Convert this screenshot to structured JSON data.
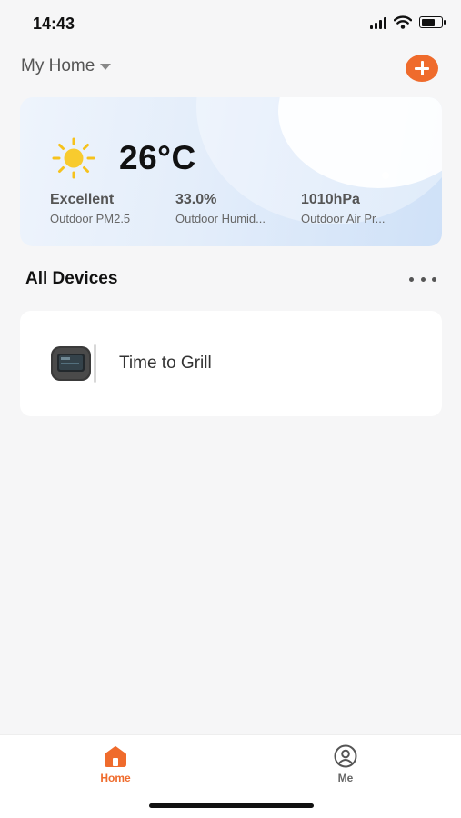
{
  "status_bar": {
    "time": "14:43",
    "signal_icon": "cellular-signal-icon",
    "wifi_icon": "wifi-icon",
    "battery_icon": "battery-icon"
  },
  "header": {
    "home_name": "My Home",
    "dropdown_icon": "caret-down-icon",
    "add_icon": "plus-circle-icon",
    "accent_color": "#ef6b2c"
  },
  "weather": {
    "icon": "sun-icon",
    "temperature": "26°C",
    "stats": [
      {
        "value": "Excellent",
        "label": "Outdoor PM2.5"
      },
      {
        "value": "33.0%",
        "label": "Outdoor Humid..."
      },
      {
        "value": "1010hPa",
        "label": "Outdoor Air Pr..."
      }
    ]
  },
  "devices_section": {
    "title": "All Devices",
    "more_icon": "more-horizontal-icon"
  },
  "devices": [
    {
      "name": "Time to Grill",
      "icon": "grill-thermometer-device-image"
    }
  ],
  "tab_bar": {
    "tabs": [
      {
        "label": "Home",
        "icon": "home-icon",
        "active": true
      },
      {
        "label": "Me",
        "icon": "profile-icon",
        "active": false
      }
    ]
  }
}
